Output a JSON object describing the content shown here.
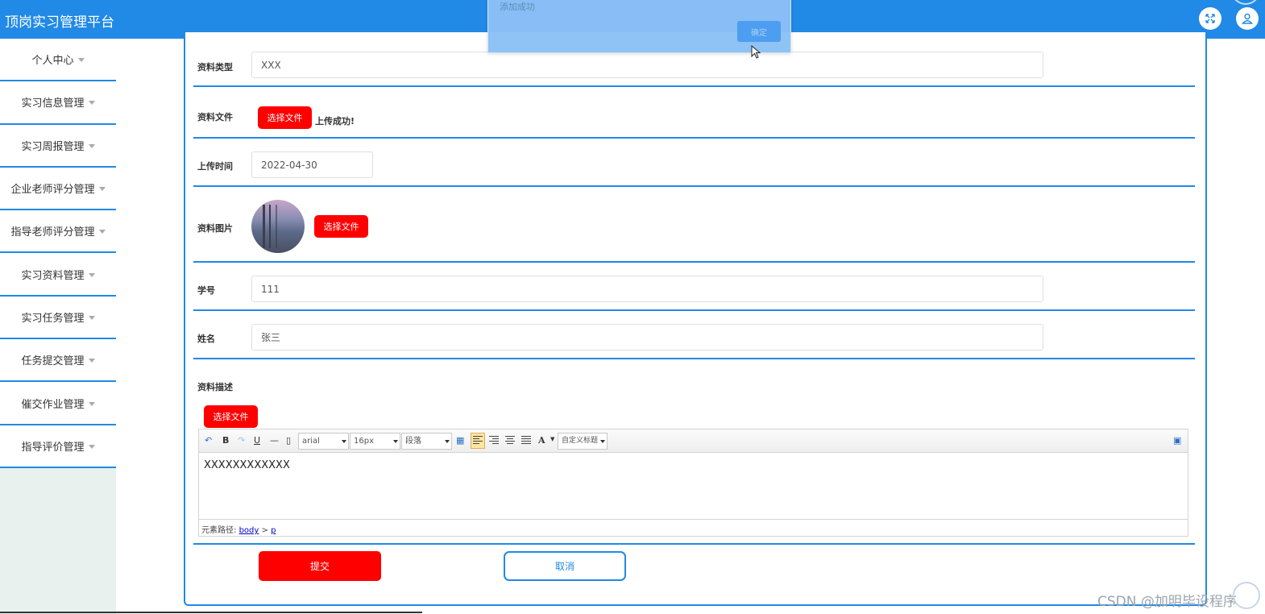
{
  "header": {
    "title": "顶岗实习管理平台",
    "expand_icon": "expand-icon",
    "user_icon": "user-icon"
  },
  "sidebar": {
    "items": [
      {
        "label": "个人中心"
      },
      {
        "label": "实习信息管理"
      },
      {
        "label": "实习周报管理"
      },
      {
        "label": "企业老师评分管理"
      },
      {
        "label": "指导老师评分管理"
      },
      {
        "label": "实习资料管理"
      },
      {
        "label": "实习任务管理"
      },
      {
        "label": "任务提交管理"
      },
      {
        "label": "催交作业管理"
      },
      {
        "label": "指导评价管理"
      }
    ]
  },
  "form": {
    "type_label": "资料类型",
    "type_value": "XXX",
    "file_label": "资料文件",
    "file_button": "选择文件",
    "file_status": "上传成功!",
    "time_label": "上传时间",
    "time_value": "2022-04-30",
    "image_label": "资料图片",
    "image_button": "选择文件",
    "student_no_label": "学号",
    "student_no_value": "111",
    "name_label": "姓名",
    "name_value": "张三",
    "desc_label": "资料描述",
    "desc_button": "选择文件",
    "submit_label": "提交",
    "cancel_label": "取消"
  },
  "editor": {
    "toolbar": {
      "bold": "B",
      "underline": "U",
      "font_family": "arial",
      "font_size": "16px",
      "paragraph": "段落",
      "font_color": "A",
      "custom_title": "自定义标题"
    },
    "content": "XXXXXXXXXXXX",
    "path_label": "元素路径:",
    "path_body": "body",
    "path_sep": ">",
    "path_p": "p"
  },
  "dialog": {
    "message": "添加成功",
    "ok_label": "确定"
  },
  "watermark": "CSDN @加明毕设程序",
  "colors": {
    "primary": "#2189e6",
    "danger": "#ff0000",
    "sidebar_bg": "#e8f1ee"
  }
}
